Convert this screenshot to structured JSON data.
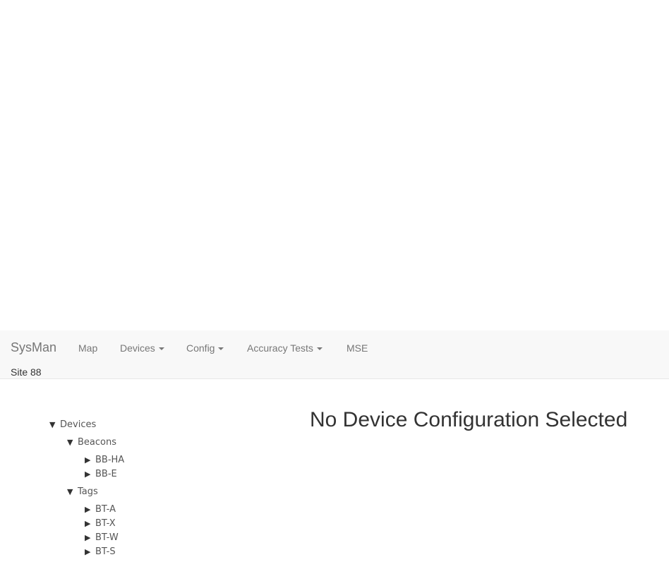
{
  "navbar": {
    "brand": "SysMan",
    "items": [
      {
        "label": "Map",
        "dropdown": false
      },
      {
        "label": "Devices",
        "dropdown": true
      },
      {
        "label": "Config",
        "dropdown": true
      },
      {
        "label": "Accuracy Tests",
        "dropdown": true
      },
      {
        "label": "MSE",
        "dropdown": false
      }
    ],
    "site": "Site 88"
  },
  "tree": {
    "root": {
      "label": "Devices",
      "expanded": true
    },
    "groups": [
      {
        "label": "Beacons",
        "expanded": true,
        "children": [
          "BB-HA",
          "BB-E"
        ]
      },
      {
        "label": "Tags",
        "expanded": true,
        "children": [
          "BT-A",
          "BT-X",
          "BT-W",
          "BT-S"
        ]
      }
    ]
  },
  "main": {
    "heading": "No Device Configuration Selected"
  },
  "icons": {
    "expanded": "triangle-down-icon",
    "collapsed": "triangle-right-icon",
    "dropdown": "caret-down-icon"
  },
  "colors": {
    "navbar_bg": "#f8f8f8",
    "nav_text": "#777777",
    "heading_text": "#333333"
  }
}
